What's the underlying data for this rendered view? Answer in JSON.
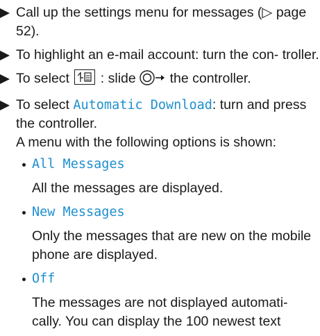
{
  "steps": [
    {
      "text": "Call up the settings menu for messages (▷ page 52)."
    },
    {
      "text": "To highlight an e-mail account: turn the con- troller."
    },
    {
      "before": "To select",
      "key_icon": "menu-key-icon",
      "mid": ": slide",
      "controller_icon": "controller-icon",
      "after": "the controller."
    },
    {
      "before": "To select",
      "ui_label": "Automatic Download",
      "after": ": turn and press the controller.",
      "note": "A menu with the following options is shown:"
    }
  ],
  "options": [
    {
      "label": "All Messages",
      "desc": "All the messages are displayed."
    },
    {
      "label": "New Messages",
      "desc": "Only the messages that are new on the mobile phone are displayed."
    },
    {
      "label": "Off",
      "desc": "The messages are not displayed automati- cally. You can display the 100 newest text"
    }
  ],
  "colors": {
    "ui_label": "#1e8fcf",
    "text": "#1a1a1a"
  }
}
